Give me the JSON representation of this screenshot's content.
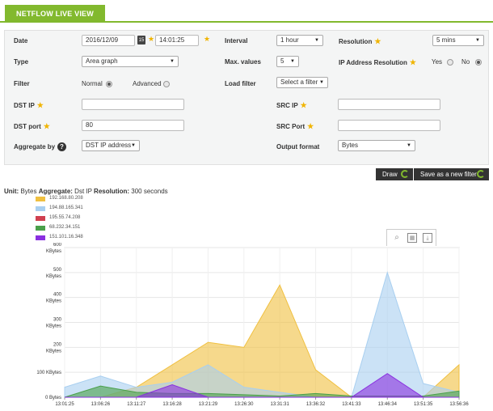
{
  "tab": {
    "label": "NETFLOW LIVE VIEW"
  },
  "form": {
    "date": {
      "label": "Date",
      "date_value": "2016/12/09",
      "time_value": "14:01:25"
    },
    "interval": {
      "label": "Interval",
      "value": "1 hour"
    },
    "resolution": {
      "label": "Resolution",
      "value": "5 mins"
    },
    "type": {
      "label": "Type",
      "value": "Area graph"
    },
    "max_values": {
      "label": "Max. values",
      "value": "5"
    },
    "ip_resolution": {
      "label": "IP Address Resolution",
      "yes": "Yes",
      "no": "No",
      "selected": "no"
    },
    "filter": {
      "label": "Filter",
      "normal": "Normal",
      "advanced": "Advanced",
      "selected": "normal"
    },
    "load_filter": {
      "label": "Load filter",
      "value": "Select a filter"
    },
    "dst_ip": {
      "label": "DST IP",
      "value": ""
    },
    "src_ip": {
      "label": "SRC IP",
      "value": ""
    },
    "dst_port": {
      "label": "DST port",
      "value": "80"
    },
    "src_port": {
      "label": "SRC Port",
      "value": ""
    },
    "aggregate_by": {
      "label": "Aggregate by",
      "value": "DST IP address"
    },
    "output_format": {
      "label": "Output format",
      "value": "Bytes"
    }
  },
  "buttons": {
    "draw": "Draw",
    "save_filter": "Save as a new filter"
  },
  "chart_info": {
    "unit_label": "Unit:",
    "unit": "Bytes",
    "aggregate_label": "Aggregate:",
    "aggregate": "Dst IP",
    "resolution_label": "Resolution:",
    "resolution": "300 seconds"
  },
  "colors": {
    "accent": "#82b92e"
  },
  "chart_data": {
    "type": "area",
    "x": [
      "13:01:25",
      "13:06:26",
      "13:11:27",
      "13:16:28",
      "13:21:29",
      "13:26:30",
      "13:31:31",
      "13:36:32",
      "13:41:33",
      "13:46:34",
      "13:51:35",
      "13:56:36"
    ],
    "y_ticks": [
      "0 Bytes",
      "100 KBytes",
      "200 KBytes",
      "300 KBytes",
      "400 KBytes",
      "500 KBytes",
      "600 KBytes"
    ],
    "ylim": [
      0,
      600
    ],
    "series": [
      {
        "name": "192.168.80.208",
        "color": "#f0c040",
        "values": [
          0,
          0,
          40,
          130,
          220,
          200,
          450,
          110,
          0,
          0,
          0,
          130
        ]
      },
      {
        "name": "194.88.165.341",
        "color": "#a8cff0",
        "values": [
          40,
          85,
          40,
          60,
          130,
          40,
          20,
          0,
          0,
          500,
          55,
          20
        ]
      },
      {
        "name": "195.55.74.208",
        "color": "#d04050",
        "values": [
          0,
          0,
          0,
          0,
          0,
          0,
          0,
          0,
          0,
          0,
          0,
          0
        ]
      },
      {
        "name": "68.232.34.151",
        "color": "#4aa04a",
        "values": [
          0,
          45,
          20,
          15,
          15,
          10,
          5,
          15,
          5,
          5,
          5,
          25
        ]
      },
      {
        "name": "151.101.16.348",
        "color": "#8a30e0",
        "values": [
          0,
          0,
          0,
          50,
          0,
          0,
          0,
          0,
          0,
          95,
          0,
          0
        ]
      }
    ]
  }
}
